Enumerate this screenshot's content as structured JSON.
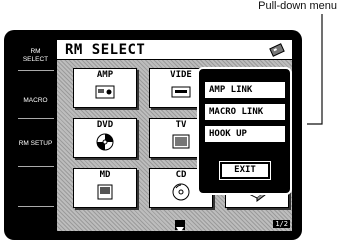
{
  "callout": {
    "label": "Pull-down menu"
  },
  "sidebar": {
    "items": [
      {
        "label": "RM\nSELECT"
      },
      {
        "label": "MACRO"
      },
      {
        "label": "RM SETUP"
      }
    ]
  },
  "header": {
    "title": "RM SELECT",
    "icon": "remote-icon"
  },
  "tiles": [
    {
      "label": "AMP",
      "icon": "amp-icon"
    },
    {
      "label": "VIDE",
      "icon": "video-icon"
    },
    {
      "label": "DVD",
      "icon": "disc-icon"
    },
    {
      "label": "TV",
      "icon": "tv-icon"
    },
    {
      "label": "MD",
      "icon": "md-icon"
    },
    {
      "label": "CD",
      "icon": "cd-icon"
    },
    {
      "label": "",
      "icon": "device-icon"
    }
  ],
  "popup": {
    "items": [
      {
        "label": "AMP LINK"
      },
      {
        "label": "MACRO LINK"
      },
      {
        "label": "HOOK UP"
      }
    ],
    "exit_label": "EXIT"
  },
  "footer": {
    "page": "1/2"
  }
}
